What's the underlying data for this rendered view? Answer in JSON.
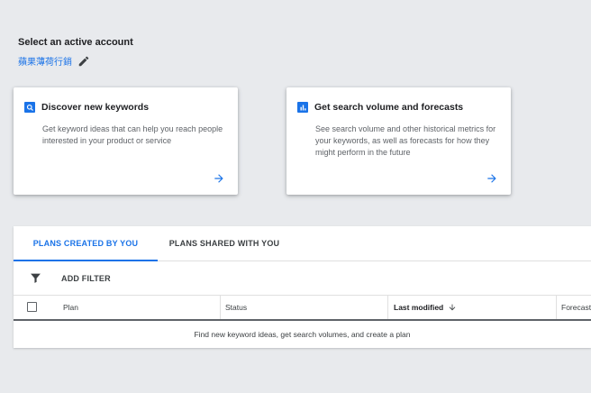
{
  "account": {
    "heading": "Select an active account",
    "name": "蘋果薄荷行銷"
  },
  "cards": [
    {
      "title": "Discover new keywords",
      "description": "Get keyword ideas that can help you reach people interested in your product or service",
      "icon": "search-icon"
    },
    {
      "title": "Get search volume and forecasts",
      "description": "See search volume and other historical metrics for your keywords, as well as forecasts for how they might perform in the future",
      "icon": "bar-chart-icon"
    }
  ],
  "plans": {
    "tabs": [
      "PLANS CREATED BY YOU",
      "PLANS SHARED WITH YOU"
    ],
    "active_tab": 0,
    "add_filter_label": "ADD FILTER",
    "columns": [
      "Plan",
      "Status",
      "Last modified",
      "Forecast"
    ],
    "empty_message": "Find new keyword ideas, get search volumes, and create a plan"
  },
  "colors": {
    "accent": "#1a73e8",
    "background": "#e8eaed"
  }
}
